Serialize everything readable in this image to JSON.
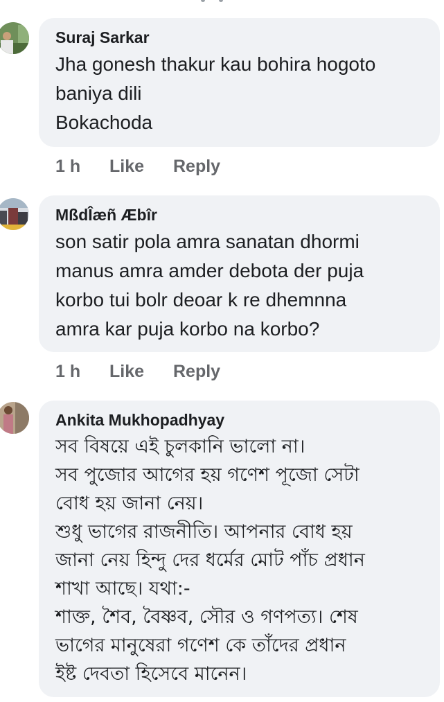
{
  "comments": [
    {
      "author": "Suraj Sarkar",
      "lines": [
        "Jha gonesh thakur kau bohira hogoto",
        "baniya dili",
        "Bokachoda"
      ],
      "time": "1 h",
      "like_label": "Like",
      "reply_label": "Reply"
    },
    {
      "author": "MßdÎæñ Æbîr",
      "lines": [
        "son satir pola amra sanatan dhormi",
        "manus amra amder debota der puja",
        "korbo tui bolr deoar k re dhemnna",
        "amra kar puja korbo na korbo?"
      ],
      "time": "1 h",
      "like_label": "Like",
      "reply_label": "Reply"
    },
    {
      "author": "Ankita Mukhopadhyay",
      "lines": [
        "সব বিষয়ে এই চুলকানি ভালো না।",
        "সব পুজোর আগের হয় গণেশ পূজো সেটা",
        "বোধ হয় জানা নেয়।",
        "শুধু ভাগের রাজনীতি। আপনার বোধ হয়",
        "জানা নেয় হিন্দু দের ধর্মের মোট পাঁচ প্রধান",
        "শাখা আছে। যথা:-",
        "শাক্ত, শৈব, বৈষ্ণব, সৌর ও গণপত্য। শেষ",
        "ভাগের মানুষেরা গণেশ কে তাঁদের প্রধান",
        "ইষ্ট দেবতা হিসেবে মানেন।"
      ]
    }
  ]
}
